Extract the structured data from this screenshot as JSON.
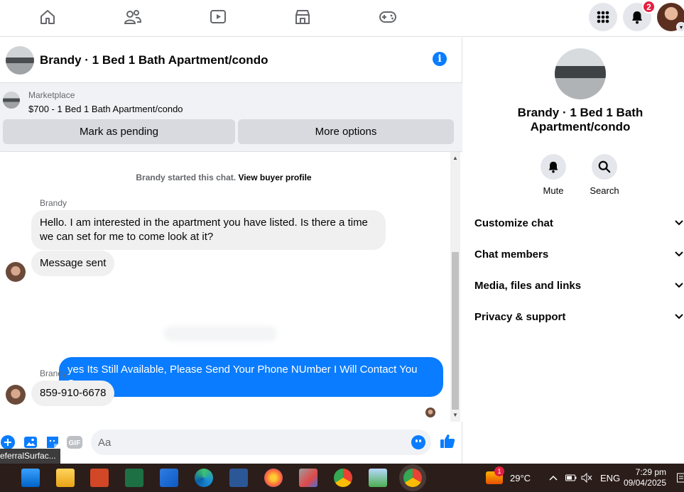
{
  "topnav": {
    "items": [
      "home-icon",
      "friends-icon",
      "watch-icon",
      "marketplace-icon",
      "gaming-icon"
    ],
    "notification_count": "2"
  },
  "chat": {
    "title": "Brandy · 1 Bed 1 Bath Apartment/condo",
    "marketplace_label": "Marketplace",
    "listing": "$700 - 1 Bed 1 Bath Apartment/condo",
    "mark_pending": "Mark as pending",
    "more_options": "More options",
    "started_text": "Brandy started this chat.",
    "view_profile": "View buyer profile",
    "messages": [
      {
        "sender": "Brandy",
        "text": "Hello. I am interested in the apartment you have listed. Is there a time we can set for me to come look at it?"
      },
      {
        "text": "Message sent"
      },
      {
        "text": "yes Its Still Available, Please Send Your Phone NUmber I Will Contact You Soon"
      },
      {
        "sender": "Brandy",
        "text": "859-910-6678"
      }
    ],
    "composer_placeholder": "Aa",
    "gif_label": "GIF",
    "tooltip": "eferralSurfac..."
  },
  "panel": {
    "title": "Brandy · 1 Bed 1 Bath Apartment/condo",
    "mute": "Mute",
    "search": "Search",
    "rows": [
      "Customize chat",
      "Chat members",
      "Media, files and links",
      "Privacy & support"
    ]
  },
  "taskbar": {
    "weather_badge": "1",
    "temperature": "29°C",
    "language": "ENG",
    "time": "7:29 pm",
    "date": "09/04/2025"
  },
  "colors": {
    "accent": "#0a7cff",
    "notification": "#e41e3f"
  }
}
